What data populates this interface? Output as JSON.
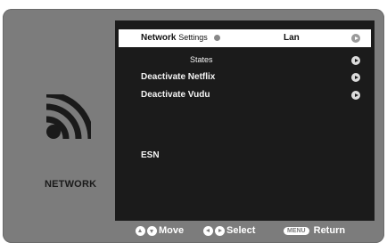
{
  "category": {
    "label": "NETWORK",
    "icon": "wifi-icon"
  },
  "menu": {
    "network_settings": {
      "label_bold": "Network",
      "label_small": "Settings",
      "value": "Lan",
      "selected": true
    },
    "states": {
      "label": "States"
    },
    "deactivate_netflix": {
      "label": "Deactivate Netflix"
    },
    "deactivate_vudu": {
      "label": "Deactivate Vudu"
    },
    "esn": {
      "label": "ESN"
    }
  },
  "footer": {
    "move": "Move",
    "select": "Select",
    "menu_key": "MENU",
    "return": "Return"
  },
  "colors": {
    "frame": "#7c7c7c",
    "panel": "#1b1b1b",
    "highlight": "#ffffff"
  }
}
